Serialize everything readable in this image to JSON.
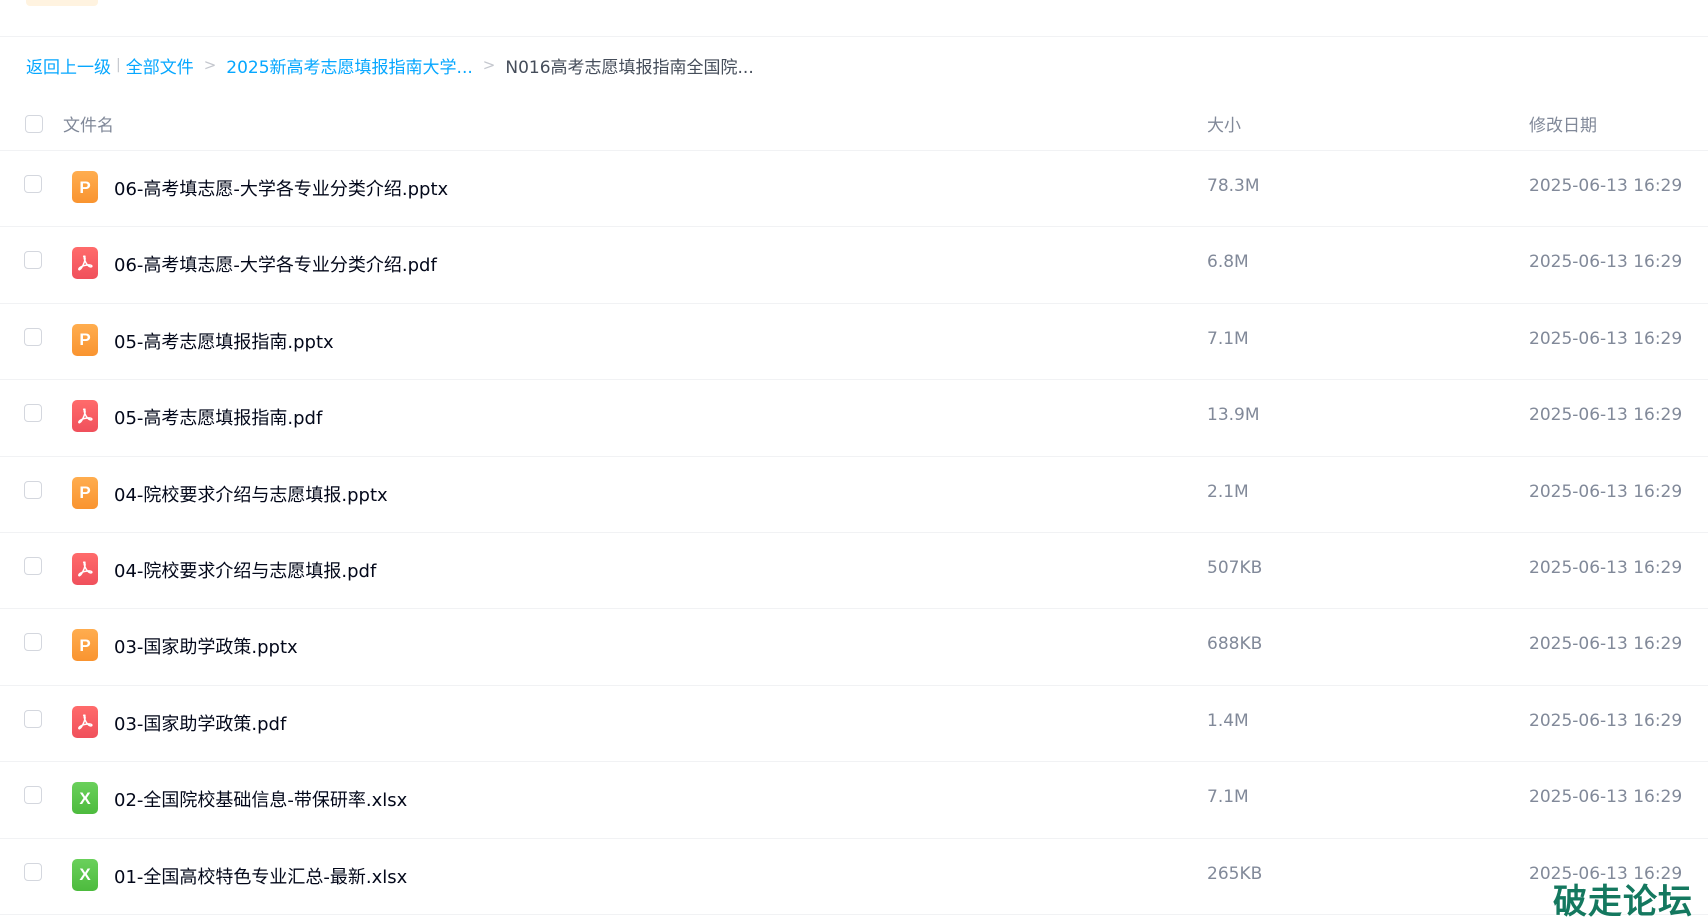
{
  "top_strip": {
    "partial_text": "返回上一级 全部文件",
    "partial_bold": "N"
  },
  "breadcrumb": {
    "back": "返回上一级",
    "separator_bar": "|",
    "root": "全部文件",
    "separator_gt": ">",
    "level1": "2025新高考志愿填报指南大学...",
    "current": "N016高考志愿填报指南全国院..."
  },
  "table": {
    "headers": {
      "name": "文件名",
      "size": "大小",
      "date": "修改日期"
    },
    "files": [
      {
        "name": "06-高考填志愿-大学各专业分类介绍.pptx",
        "type": "ppt",
        "icon": "ppt-file-icon",
        "glyph": "P",
        "size": "78.3M",
        "date": "2025-06-13 16:29"
      },
      {
        "name": "06-高考填志愿-大学各专业分类介绍.pdf",
        "type": "pdf",
        "icon": "pdf-file-icon",
        "glyph": "",
        "size": "6.8M",
        "date": "2025-06-13 16:29"
      },
      {
        "name": "05-高考志愿填报指南.pptx",
        "type": "ppt",
        "icon": "ppt-file-icon",
        "glyph": "P",
        "size": "7.1M",
        "date": "2025-06-13 16:29"
      },
      {
        "name": "05-高考志愿填报指南.pdf",
        "type": "pdf",
        "icon": "pdf-file-icon",
        "glyph": "",
        "size": "13.9M",
        "date": "2025-06-13 16:29"
      },
      {
        "name": "04-院校要求介绍与志愿填报.pptx",
        "type": "ppt",
        "icon": "ppt-file-icon",
        "glyph": "P",
        "size": "2.1M",
        "date": "2025-06-13 16:29"
      },
      {
        "name": "04-院校要求介绍与志愿填报.pdf",
        "type": "pdf",
        "icon": "pdf-file-icon",
        "glyph": "",
        "size": "507KB",
        "date": "2025-06-13 16:29"
      },
      {
        "name": "03-国家助学政策.pptx",
        "type": "ppt",
        "icon": "ppt-file-icon",
        "glyph": "P",
        "size": "688KB",
        "date": "2025-06-13 16:29"
      },
      {
        "name": "03-国家助学政策.pdf",
        "type": "pdf",
        "icon": "pdf-file-icon",
        "glyph": "",
        "size": "1.4M",
        "date": "2025-06-13 16:29"
      },
      {
        "name": "02-全国院校基础信息-带保研率.xlsx",
        "type": "xls",
        "icon": "excel-file-icon",
        "glyph": "X",
        "size": "7.1M",
        "date": "2025-06-13 16:29"
      },
      {
        "name": "01-全国高校特色专业汇总-最新.xlsx",
        "type": "xls",
        "icon": "excel-file-icon",
        "glyph": "X",
        "size": "265KB",
        "date": "2025-06-13 16:29"
      }
    ]
  },
  "watermark": "破走论坛",
  "colors": {
    "link": "#06a7ff",
    "ppt": "#f99430",
    "pdf": "#f0505c",
    "xls": "#4dbb3e",
    "muted": "#818999",
    "watermark": "#14785f"
  }
}
